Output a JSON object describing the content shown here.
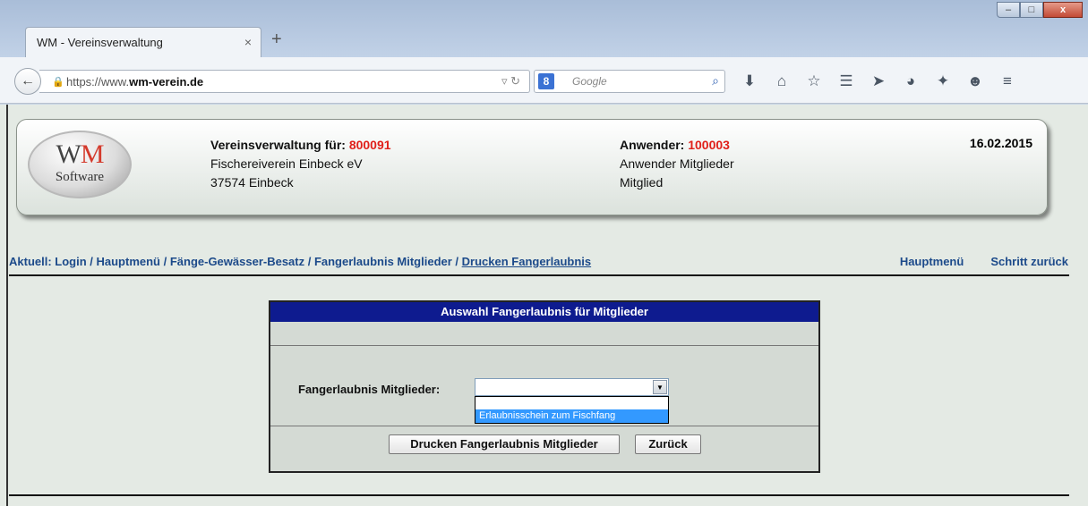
{
  "browser": {
    "tab_title": "WM - Vereinsverwaltung",
    "tab_close": "×",
    "new_tab": "+",
    "url_prefix": "https://www.",
    "url_domain": "wm-verein.de",
    "search_placeholder": "Google",
    "window_controls": {
      "minimize": "–",
      "maximize": "□",
      "close": "x"
    }
  },
  "header": {
    "logo_wm_w": "W",
    "logo_wm_m": "M",
    "logo_software": "Software",
    "verein_label": "Vereinsverwaltung für:",
    "verein_id": "800091",
    "verein_name": "Fischereiverein Einbeck eV",
    "verein_city": "37574 Einbeck",
    "user_label": "Anwender:",
    "user_id": "100003",
    "user_role": "Anwender Mitglieder",
    "user_type": "Mitglied",
    "date": "16.02.2015"
  },
  "breadcrumb": {
    "prefix": "Aktuell: Login / Hauptmenü / Fänge-Gewässer-Besatz / Fangerlaubnis Mitglieder / ",
    "current": "Drucken Fangerlaubnis"
  },
  "toplinks": {
    "main_menu": "Hauptmenü",
    "step_back": "Schritt zurück"
  },
  "panel": {
    "title": "Auswahl Fangerlaubnis für Mitglieder",
    "field_label": "Fangerlaubnis Mitglieder:",
    "select_value": "",
    "options": [
      "",
      "Erlaubnisschein zum Fischfang"
    ],
    "print_button": "Drucken Fangerlaubnis Mitglieder",
    "back_button": "Zurück"
  },
  "colors": {
    "panel_title_bg": "#0e1b8f",
    "highlight": "#e0201a",
    "link": "#1c4a8a",
    "selected_option": "#3399ff"
  }
}
